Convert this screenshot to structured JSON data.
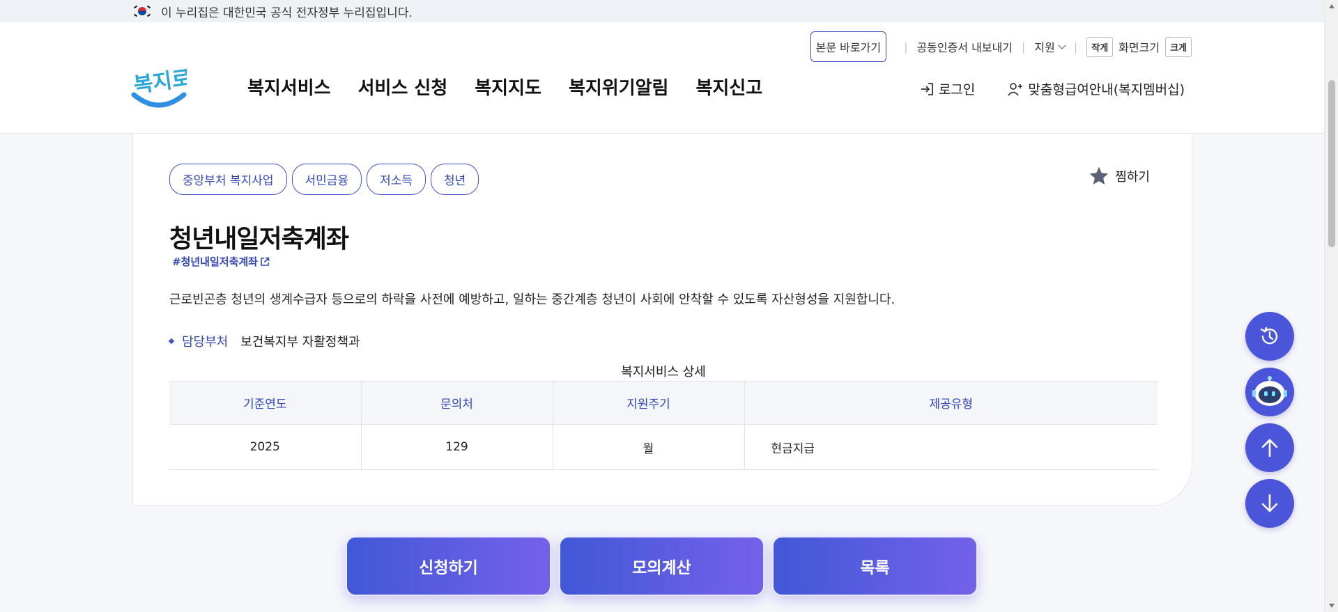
{
  "gov_banner": {
    "text": "이 누리집은 대한민국 공식 전자정부 누리집입니다."
  },
  "utility": {
    "skip_to_content": "본문 바로가기",
    "cert_export": "공동인증서 내보내기",
    "support": "지원",
    "font_small": "작게",
    "font_size_label": "화면크기",
    "font_large": "크게"
  },
  "logo": {
    "text": "복지로"
  },
  "nav": {
    "items": [
      "복지서비스",
      "서비스 신청",
      "복지지도",
      "복지위기알림",
      "복지신고"
    ]
  },
  "auth": {
    "login": "로그인",
    "membership": "맞춤형급여안내(복지멤버십)"
  },
  "service": {
    "tags": [
      "중앙부처 복지사업",
      "서민금융",
      "저소득",
      "청년"
    ],
    "favorite": "찜하기",
    "title": "청년내일저축계좌",
    "hashtag": "#청년내일저축계좌",
    "description": "근로빈곤층 청년의 생계수급자 등으로의 하락을 사전에 예방하고, 일하는 중간계층 청년이 사회에 안착할 수 있도록 자산형성을 지원합니다.",
    "dept_label": "담당부처",
    "dept_value": "보건복지부 자활정책과"
  },
  "detail_table": {
    "caption": "복지서비스 상세",
    "headers": [
      "기준연도",
      "문의처",
      "지원주기",
      "제공유형"
    ],
    "row": [
      "2025",
      "129",
      "월",
      "현금지급"
    ]
  },
  "actions": {
    "apply": "신청하기",
    "simulate": "모의계산",
    "list": "목록"
  },
  "colors": {
    "accent": "#3246b8",
    "button_gradient_start": "#4158d6",
    "button_gradient_end": "#7461ea",
    "float_button": "#4b55d9"
  }
}
